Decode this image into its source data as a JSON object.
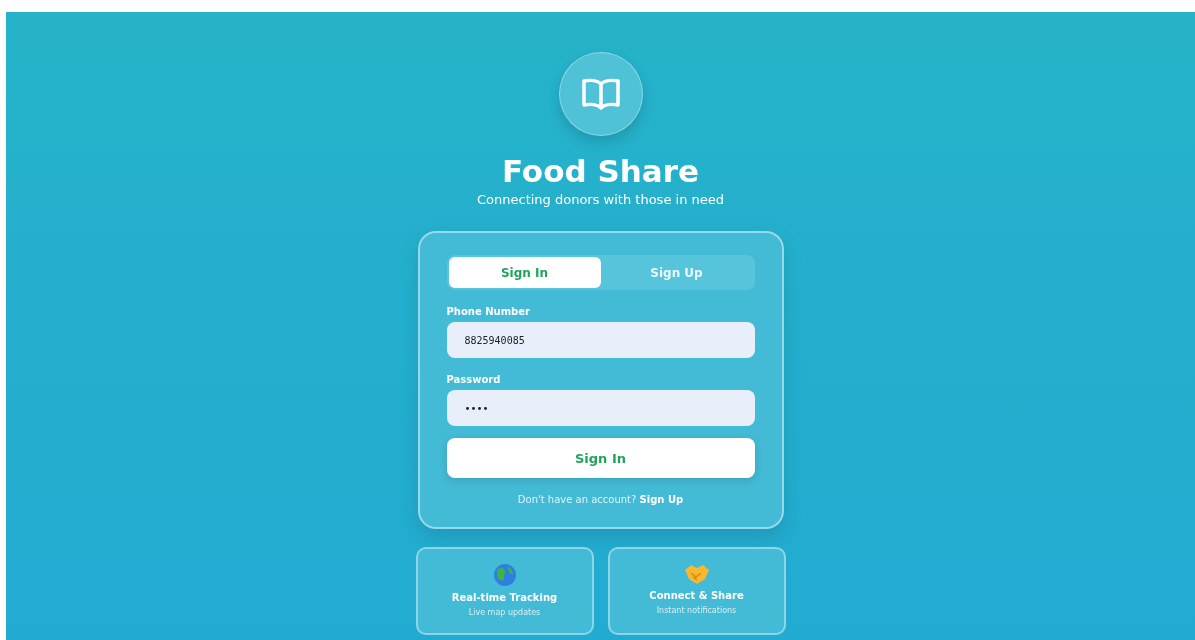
{
  "header": {
    "title": "Food Share",
    "subtitle": "Connecting donors with those in need"
  },
  "tabs": [
    {
      "label": "Sign In",
      "selected": true
    },
    {
      "label": "Sign Up",
      "selected": false
    }
  ],
  "fields": [
    {
      "label": "Phone Number",
      "value": "8825940085"
    },
    {
      "label": "Password",
      "value": "••••"
    }
  ],
  "submit": "Sign In",
  "footer": {
    "text": "Don't have an account?",
    "link": "Sign Up"
  },
  "features": [
    {
      "kind": "globe",
      "title": "Real-time Tracking",
      "subtitle": "Live map updates"
    },
    {
      "kind": "handshake",
      "title": "Connect & Share",
      "subtitle": "Instant notifications"
    }
  ]
}
